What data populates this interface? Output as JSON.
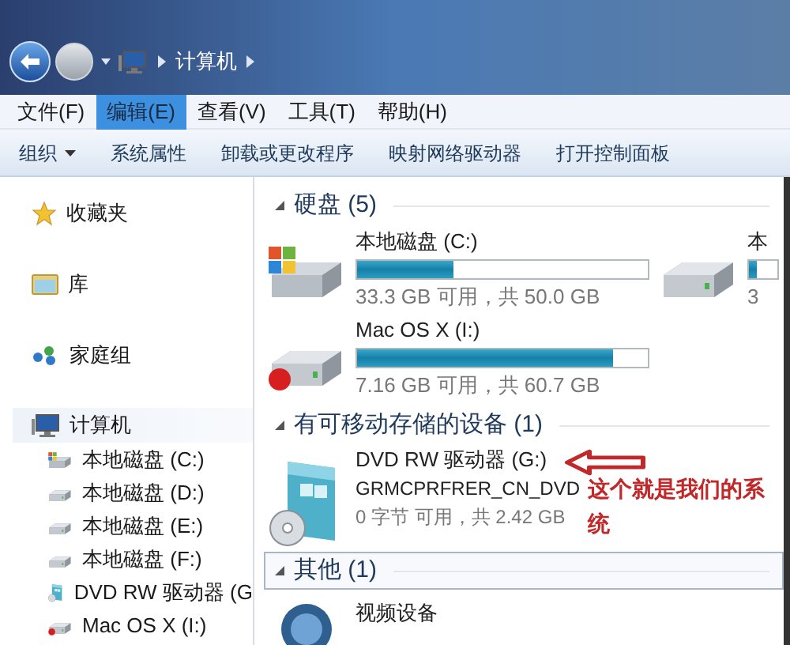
{
  "address": {
    "crumbs": [
      "计算机"
    ]
  },
  "menu": [
    {
      "label": "文件(F)",
      "selected": false
    },
    {
      "label": "编辑(E)",
      "selected": true
    },
    {
      "label": "查看(V)",
      "selected": false
    },
    {
      "label": "工具(T)",
      "selected": false
    },
    {
      "label": "帮助(H)",
      "selected": false
    }
  ],
  "toolbar": [
    {
      "label": "组织",
      "dropdown": true
    },
    {
      "label": "系统属性",
      "dropdown": false
    },
    {
      "label": "卸载或更改程序",
      "dropdown": false
    },
    {
      "label": "映射网络驱动器",
      "dropdown": false
    },
    {
      "label": "打开控制面板",
      "dropdown": false
    }
  ],
  "nav": [
    {
      "label": "收藏夹",
      "kind": "favorites",
      "selected": false
    },
    {
      "label": "库",
      "kind": "libraries",
      "selected": false
    },
    {
      "label": "家庭组",
      "kind": "homegroup",
      "selected": false
    },
    {
      "label": "计算机",
      "kind": "computer",
      "selected": true,
      "children": [
        {
          "label": "本地磁盘 (C:)",
          "kind": "system-drive"
        },
        {
          "label": "本地磁盘 (D:)",
          "kind": "drive"
        },
        {
          "label": "本地磁盘 (E:)",
          "kind": "drive"
        },
        {
          "label": "本地磁盘 (F:)",
          "kind": "drive"
        },
        {
          "label": "DVD RW 驱动器 (G",
          "kind": "dvd"
        },
        {
          "label": "Mac OS X (I:)",
          "kind": "mac-drive"
        }
      ]
    }
  ],
  "groups": [
    {
      "title": "硬盘 (5)",
      "focused": false,
      "items": [
        {
          "kind": "system-drive",
          "name": "本地磁盘 (C:)",
          "level": 0.33,
          "capacity": "33.3 GB 可用，共 50.0 GB"
        },
        {
          "kind": "drive",
          "name": "本",
          "level": 0.3,
          "capacity": "3"
        },
        {
          "kind": "mac-drive",
          "name": "Mac OS X (I:)",
          "level": 0.88,
          "capacity": "7.16 GB 可用，共 60.7 GB"
        }
      ]
    },
    {
      "title": "有可移动存储的设备 (1)",
      "focused": false,
      "items": [
        {
          "kind": "dvd",
          "name": "DVD RW 驱动器 (G:)",
          "label": "GRMCPRFRER_CN_DVD",
          "capacity": "0 字节 可用，共 2.42 GB"
        }
      ]
    },
    {
      "title": "其他 (1)",
      "focused": true,
      "items": [
        {
          "kind": "camera",
          "name": "视频设备"
        }
      ]
    }
  ],
  "annotation": {
    "text": "这个就是我们的系统"
  }
}
